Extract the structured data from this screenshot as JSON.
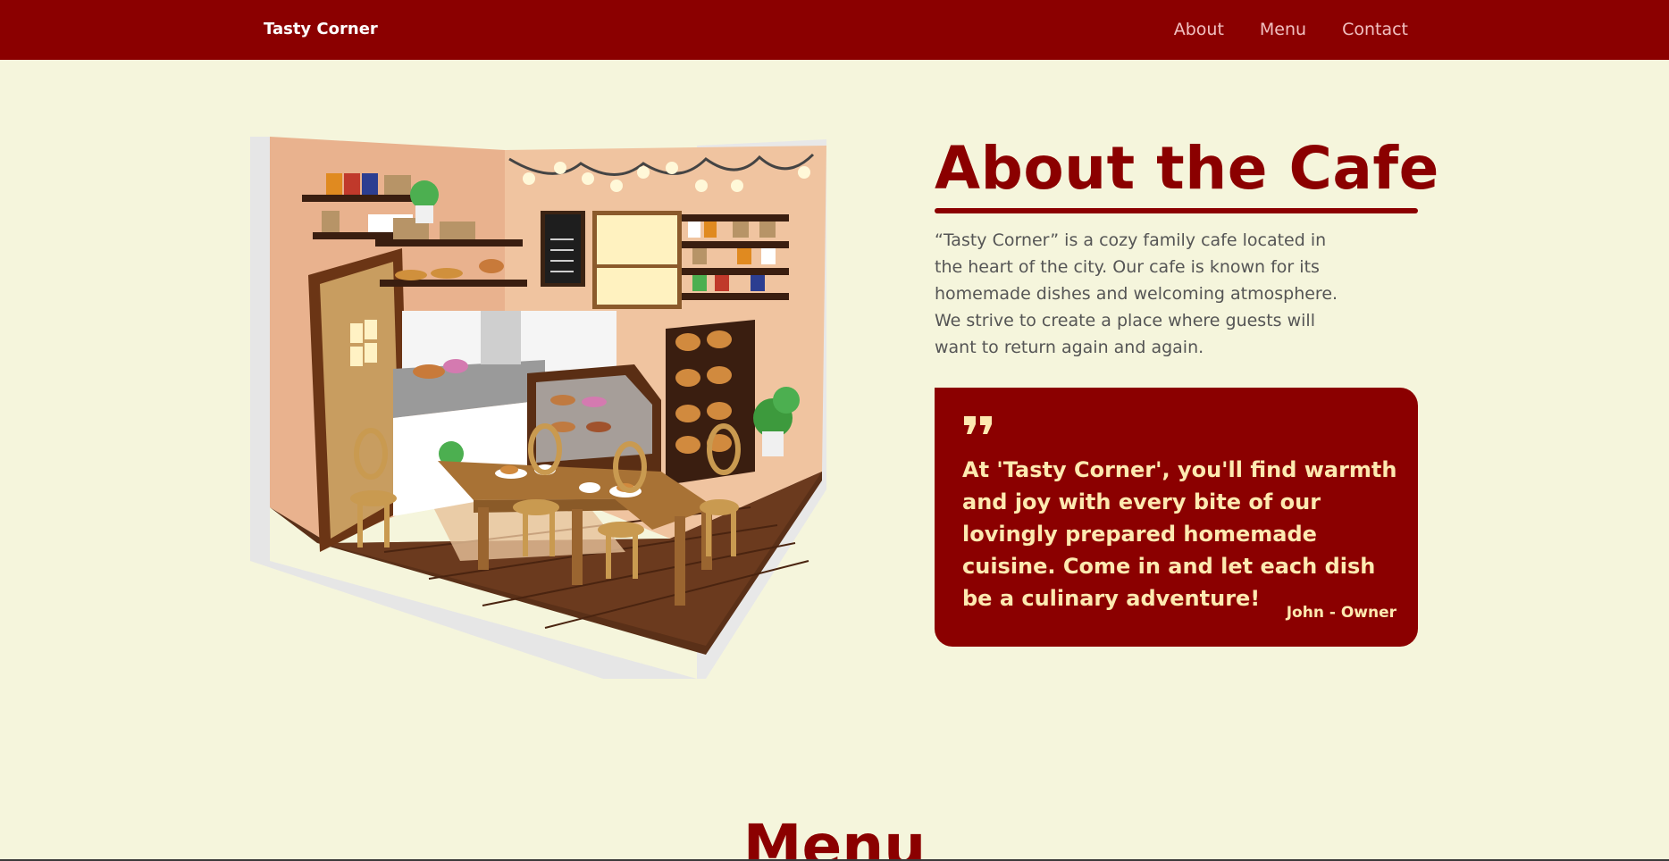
{
  "navbar": {
    "brand": "Tasty Corner",
    "links": [
      "About",
      "Menu",
      "Contact"
    ]
  },
  "about": {
    "title": "About the Cafe",
    "description": "“Tasty Corner” is a cozy family cafe located in the heart of the city. Our cafe is known for its homemade dishes and welcoming atmosphere. We strive to create a place where guests will want to return again and again.",
    "quote": {
      "text": "At 'Tasty Corner', you'll find warmth and joy with every bite of our lovingly prepared homemade cuisine. Come in and let each dish be a culinary adventure!",
      "author": "John - Owner"
    }
  },
  "menu": {
    "heading": "Menu"
  },
  "colors": {
    "primary": "#8b0000",
    "background": "#f5f5dc",
    "quote_text": "#fde9b0"
  }
}
